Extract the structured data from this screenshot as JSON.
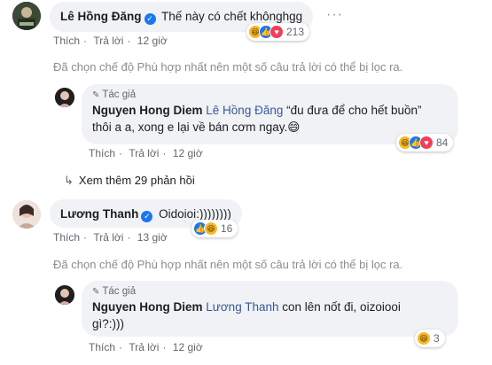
{
  "comments": [
    {
      "author": "Lê Hồng Đăng",
      "text": "Thế này có chết khônghgg",
      "actions": {
        "like": "Thích",
        "reply": "Trả lời",
        "time": "12 giờ"
      },
      "reaction_count": "213",
      "reactions": [
        "haha-icon",
        "like-icon",
        "love-icon"
      ]
    },
    {
      "author": "Lương Thanh",
      "text": "Oidoioi:))))))))",
      "actions": {
        "like": "Thích",
        "reply": "Trả lời",
        "time": "13 giờ"
      },
      "reaction_count": "16",
      "reactions": [
        "like-icon",
        "haha-icon"
      ]
    }
  ],
  "filter_note": "Đã chọn chế độ Phù hợp nhất nên một số câu trả lời có thể bị lọc ra.",
  "replies": [
    {
      "author_tag": "Tác giả",
      "author": "Nguyen Hong Diem",
      "mention": "Lê Hồng Đăng",
      "text_line1": "“đu đưa để cho hết buồn”",
      "text_line2": "thôi a a, xong e lại về bán cơm ngay.",
      "emoji": "😄",
      "actions": {
        "like": "Thích",
        "reply": "Trả lời",
        "time": "12 giờ"
      },
      "reaction_count": "84",
      "reactions": [
        "haha-icon",
        "like-icon",
        "love-icon"
      ]
    },
    {
      "author_tag": "Tác giả",
      "author": "Nguyen Hong Diem",
      "mention": "Lương Thanh",
      "text_line1": "con lên nốt đi, oizoiooi",
      "text_line2": "gì?:)))",
      "actions": {
        "like": "Thích",
        "reply": "Trả lời",
        "time": "12 giờ"
      },
      "reaction_count": "3",
      "reactions": [
        "haha-icon"
      ]
    }
  ],
  "view_more": "Xem thêm 29 phản hồi",
  "colors": {
    "bubble": "#f0f2f5",
    "link": "#385898",
    "meta": "#65676b",
    "like": "#1877f2",
    "love": "#f33e58",
    "haha": "#f7b928"
  }
}
